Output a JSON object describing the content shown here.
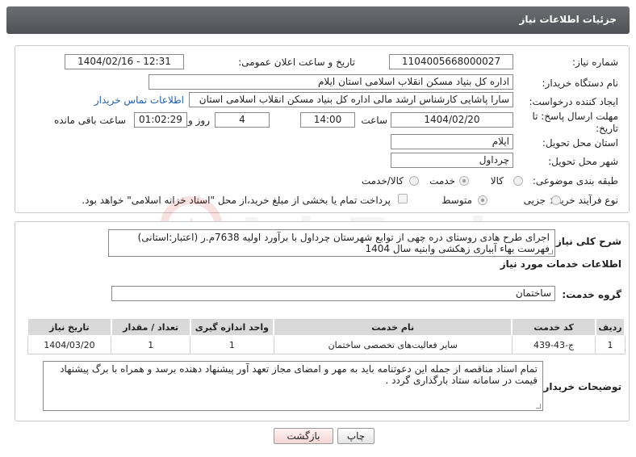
{
  "header": {
    "title": "جزئیات اطلاعات نیاز"
  },
  "fields": {
    "need_number_label": "شماره نیاز:",
    "need_number": "1104005668000027",
    "announce_label": "تاریخ و ساعت اعلان عمومی:",
    "announce_value": "1404/02/16 - 12:31",
    "buyer_org_label": "نام دستگاه خریدار:",
    "buyer_org": "اداره کل بنیاد مسکن انقلاب اسلامی استان ایلام",
    "creator_label": "ایجاد کننده درخواست:",
    "creator": "سارا پاشایی کارشناس ارشد مالی اداره کل بنیاد مسکن انقلاب اسلامی استان",
    "contact_link": "اطلاعات تماس خریدار",
    "deadline_label_1": "مهلت ارسال پاسخ: تا",
    "deadline_label_2": "تاریخ:",
    "deadline_date": "1404/02/20",
    "time_label": "ساعت",
    "deadline_time": "14:00",
    "days_value": "4",
    "days_label": "روز و",
    "remaining_time": "01:02:29",
    "remaining_label": "ساعت باقی مانده",
    "province_label": "استان محل تحویل:",
    "province": "ایلام",
    "city_label": "شهر محل تحویل:",
    "city": "چرداول",
    "category_label": "طبقه بندی موضوعی:",
    "category_options": [
      "کالا",
      "خدمت",
      "کالا/خدمت"
    ],
    "process_label": "نوع فرآیند خرید :",
    "process_options": [
      "جزیی",
      "متوسط"
    ],
    "payment_note": "پرداخت تمام یا بخشی از مبلغ خرید،از محل \"اسناد خزانه اسلامی\" خواهد بود."
  },
  "summary": {
    "label": "شرح کلی نیاز:",
    "line1": "اجرای طرح هادی روستای دره چهی از توابع شهرستان چرداول با برآورد اولیه 7638م.ر (اعتبار:استانی)",
    "line2": "فهرست بهاء آبیاری زهکشی وابنیه سال 1404"
  },
  "services": {
    "section_title": "اطلاعات خدمات مورد نیاز",
    "group_label": "گروه خدمت:",
    "group_value": "ساختمان",
    "columns": [
      "ردیف",
      "کد خدمت",
      "نام خدمت",
      "واحد اندازه گیری",
      "تعداد / مقدار",
      "تاریخ نیاز"
    ],
    "rows": [
      {
        "row": "1",
        "code": "ج-43-439",
        "name": "سایر فعالیت‌های تخصصی ساختمان",
        "unit": "1",
        "qty": "1",
        "date": "1404/03/20"
      }
    ]
  },
  "notes": {
    "label": "توضیحات خریدار:",
    "line1": "تمام اسناد مناقصه از جمله این دعوتنامه باید به مهر و امضای مجاز تعهد آور پیشنهاد دهنده برسد و همراه با برگ پیشنهاد",
    "line2": "قیمت  در سامانه ستاد بارگذاری گردد ."
  },
  "buttons": {
    "print": "چاپ",
    "back": "بازگشت"
  },
  "watermark_text": "AriaTender.neT",
  "colors": {
    "header": "#585c61",
    "link": "#1f5fb0",
    "back_button": "#fbe3e3"
  }
}
